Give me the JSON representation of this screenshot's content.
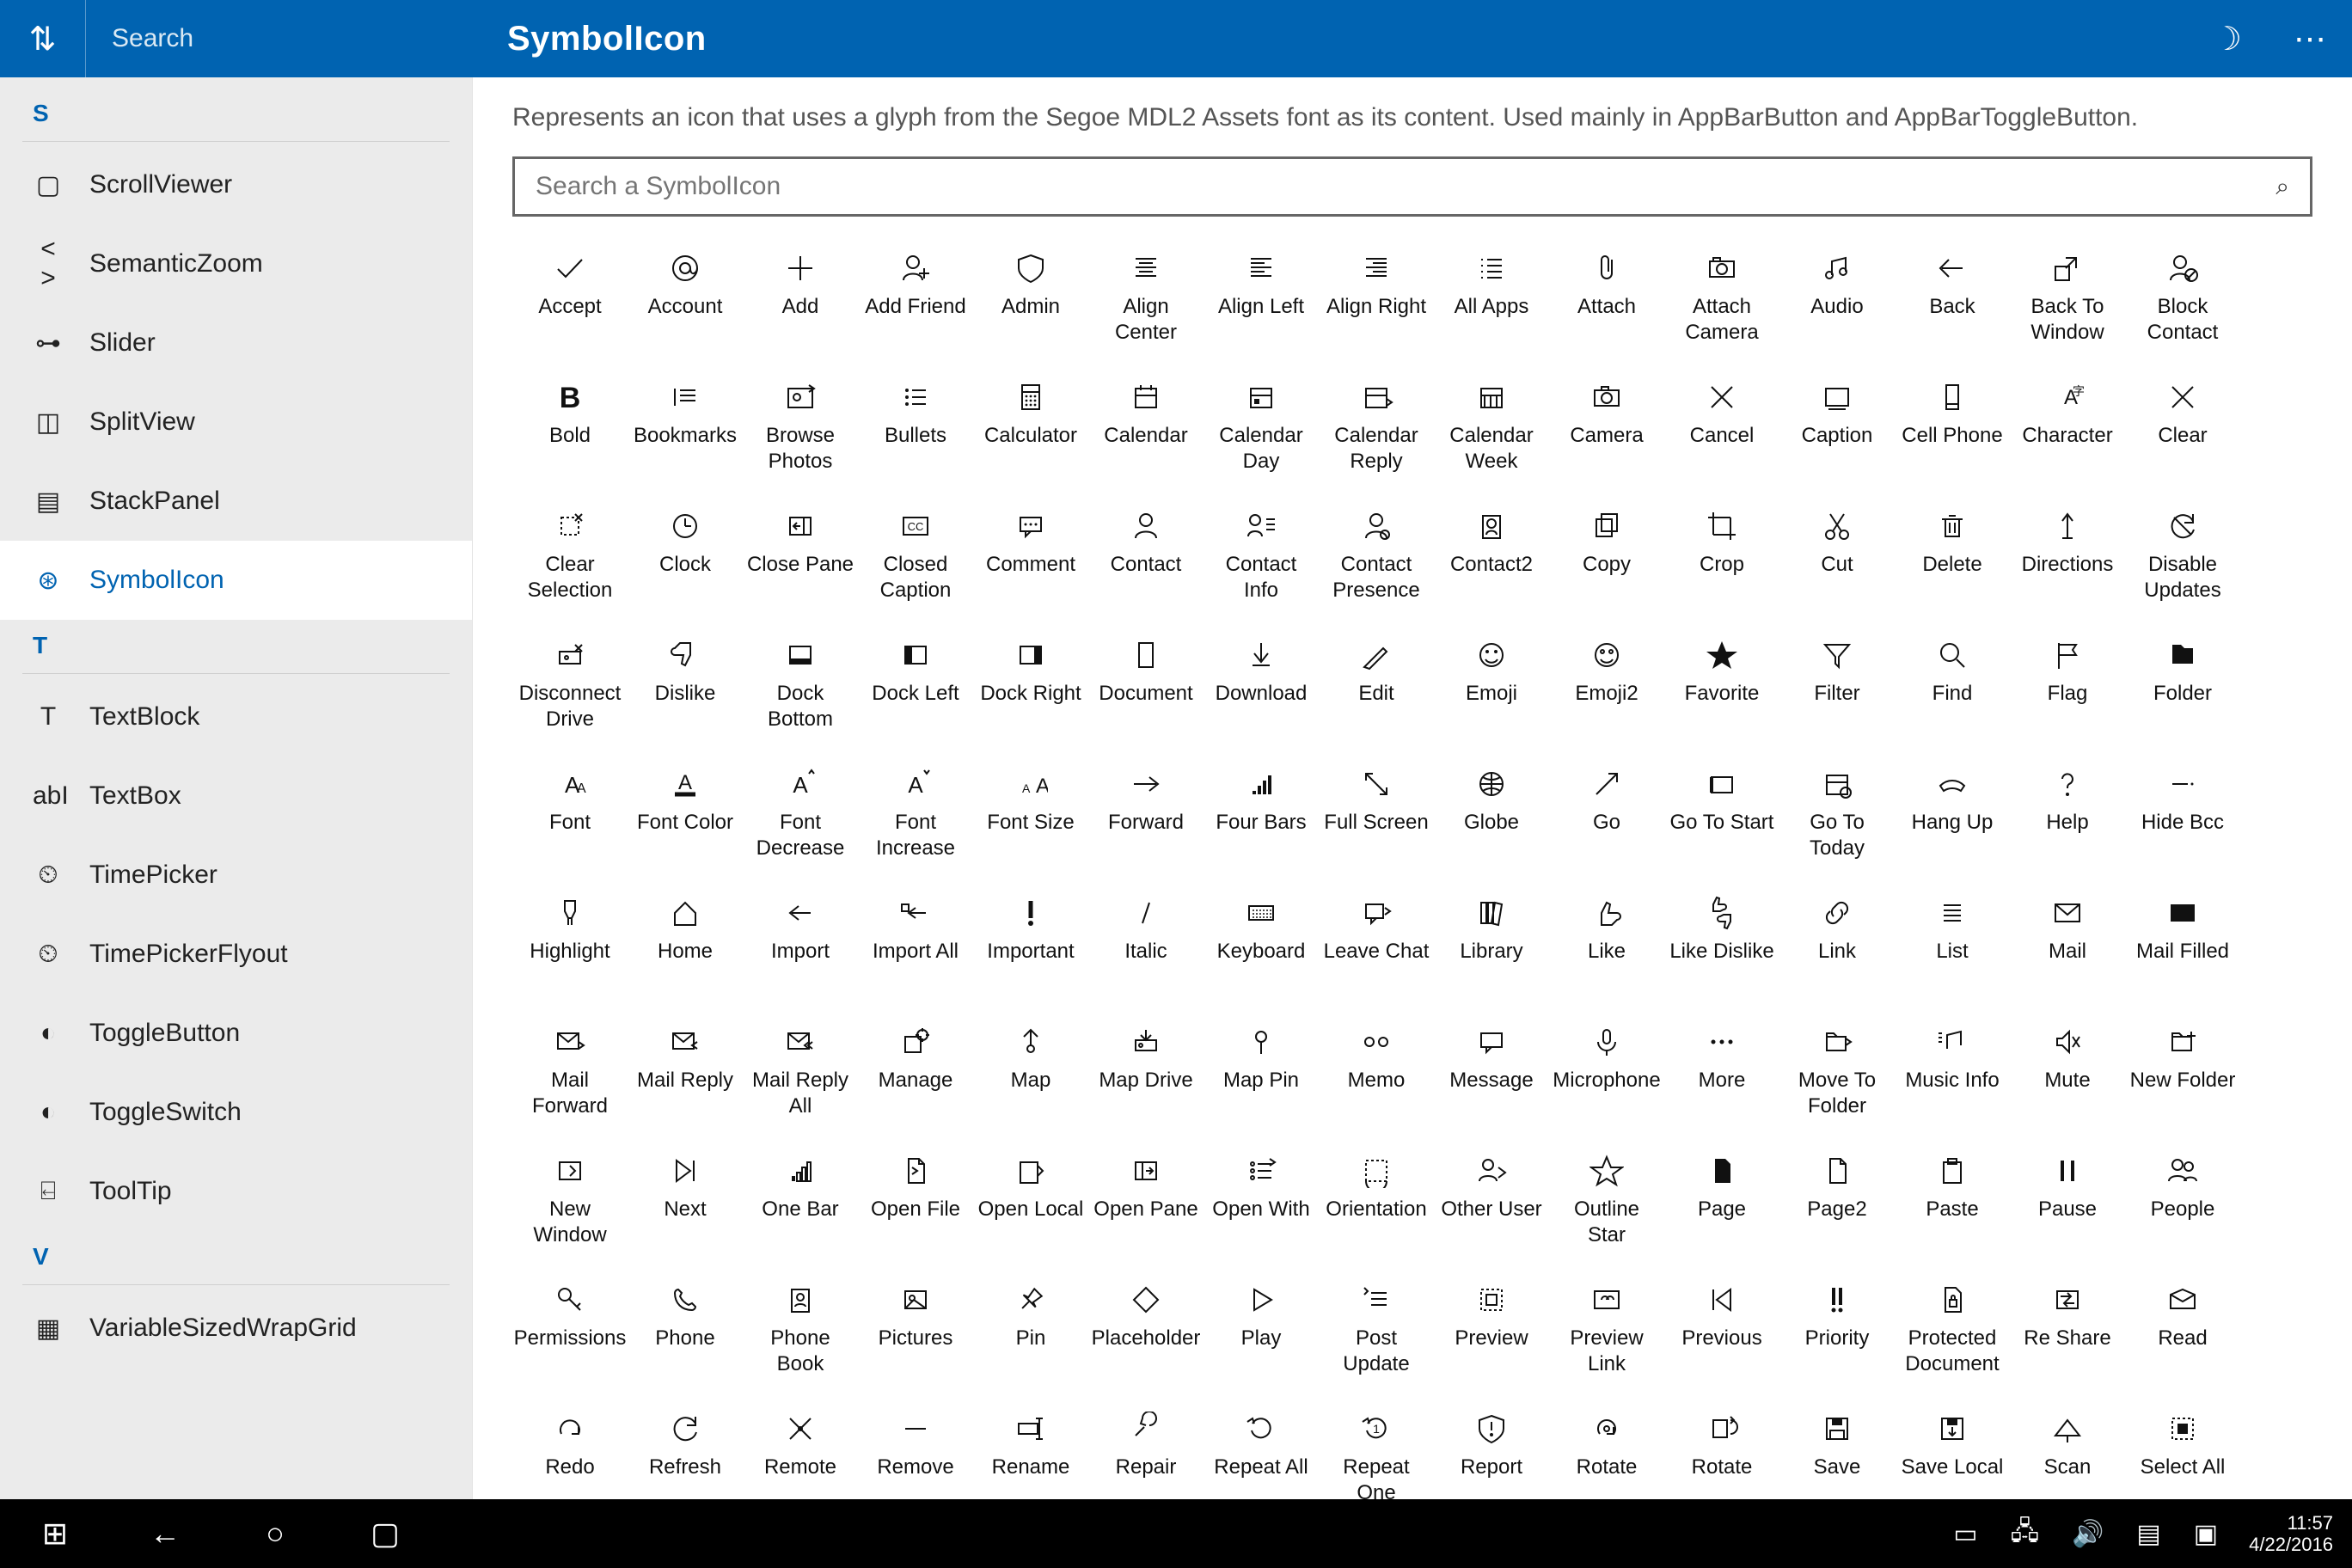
{
  "titlebar": {
    "search_placeholder": "Search",
    "title": "SymbolIcon"
  },
  "sidebar": {
    "sections": [
      {
        "letter": "S",
        "items": [
          {
            "icon": "▢",
            "label": "ScrollViewer"
          },
          {
            "icon": "< >",
            "label": "SemanticZoom"
          },
          {
            "icon": "⊶",
            "label": "Slider"
          },
          {
            "icon": "◫",
            "label": "SplitView"
          },
          {
            "icon": "▤",
            "label": "StackPanel"
          },
          {
            "icon": "⊛",
            "label": "SymbolIcon",
            "selected": true
          }
        ]
      },
      {
        "letter": "T",
        "items": [
          {
            "icon": "T",
            "label": "TextBlock"
          },
          {
            "icon": "abI",
            "label": "TextBox"
          },
          {
            "icon": "⏲",
            "label": "TimePicker"
          },
          {
            "icon": "⏲",
            "label": "TimePickerFlyout"
          },
          {
            "icon": "◐",
            "label": "ToggleButton"
          },
          {
            "icon": "◐",
            "label": "ToggleSwitch"
          },
          {
            "icon": "⍇",
            "label": "ToolTip"
          }
        ]
      },
      {
        "letter": "V",
        "items": [
          {
            "icon": "▦",
            "label": "VariableSizedWrapGrid"
          }
        ]
      }
    ]
  },
  "main": {
    "description": "Represents an icon that uses a glyph from the Segoe MDL2 Assets font as its content. Used mainly in AppBarButton and AppBarToggleButton.",
    "search_placeholder": "Search a SymbolIcon",
    "symbols": [
      {
        "g": "check",
        "l": "Accept"
      },
      {
        "g": "at",
        "l": "Account"
      },
      {
        "g": "plus",
        "l": "Add"
      },
      {
        "g": "addfriend",
        "l": "Add Friend"
      },
      {
        "g": "shield",
        "l": "Admin"
      },
      {
        "g": "alignc",
        "l": "Align Center"
      },
      {
        "g": "alignl",
        "l": "Align Left"
      },
      {
        "g": "alignr",
        "l": "Align Right"
      },
      {
        "g": "apps",
        "l": "All Apps"
      },
      {
        "g": "clip",
        "l": "Attach"
      },
      {
        "g": "attachcam",
        "l": "Attach Camera"
      },
      {
        "g": "audio",
        "l": "Audio"
      },
      {
        "g": "back",
        "l": "Back"
      },
      {
        "g": "backwin",
        "l": "Back To Window"
      },
      {
        "g": "blockcontact",
        "l": "Block Contact"
      },
      {
        "g": "bold",
        "l": "Bold"
      },
      {
        "g": "bookmarks",
        "l": "Bookmarks"
      },
      {
        "g": "browse",
        "l": "Browse Photos"
      },
      {
        "g": "bullets",
        "l": "Bullets"
      },
      {
        "g": "calc",
        "l": "Calculator"
      },
      {
        "g": "cal",
        "l": "Calendar"
      },
      {
        "g": "calday",
        "l": "Calendar Day"
      },
      {
        "g": "calreply",
        "l": "Calendar Reply"
      },
      {
        "g": "calweek",
        "l": "Calendar Week"
      },
      {
        "g": "camera",
        "l": "Camera"
      },
      {
        "g": "x",
        "l": "Cancel"
      },
      {
        "g": "caption",
        "l": "Caption"
      },
      {
        "g": "phone",
        "l": "Cell Phone"
      },
      {
        "g": "char",
        "l": "Character"
      },
      {
        "g": "x",
        "l": "Clear"
      },
      {
        "g": "clearsel",
        "l": "Clear Selection"
      },
      {
        "g": "clock",
        "l": "Clock"
      },
      {
        "g": "closepane",
        "l": "Close Pane"
      },
      {
        "g": "cc",
        "l": "Closed Caption"
      },
      {
        "g": "comment",
        "l": "Comment"
      },
      {
        "g": "contact",
        "l": "Contact"
      },
      {
        "g": "contactinfo",
        "l": "Contact Info"
      },
      {
        "g": "contactpres",
        "l": "Contact Presence"
      },
      {
        "g": "contact2",
        "l": "Contact2"
      },
      {
        "g": "copy",
        "l": "Copy"
      },
      {
        "g": "crop",
        "l": "Crop"
      },
      {
        "g": "cut",
        "l": "Cut"
      },
      {
        "g": "trash",
        "l": "Delete"
      },
      {
        "g": "directions",
        "l": "Directions"
      },
      {
        "g": "disableup",
        "l": "Disable Updates"
      },
      {
        "g": "discdrive",
        "l": "Disconnect Drive"
      },
      {
        "g": "dislike",
        "l": "Dislike"
      },
      {
        "g": "dockb",
        "l": "Dock Bottom"
      },
      {
        "g": "dockl",
        "l": "Dock Left"
      },
      {
        "g": "dockr",
        "l": "Dock Right"
      },
      {
        "g": "doc",
        "l": "Document"
      },
      {
        "g": "download",
        "l": "Download"
      },
      {
        "g": "edit",
        "l": "Edit"
      },
      {
        "g": "emoji",
        "l": "Emoji"
      },
      {
        "g": "emoji2",
        "l": "Emoji2"
      },
      {
        "g": "star",
        "l": "Favorite"
      },
      {
        "g": "filter",
        "l": "Filter"
      },
      {
        "g": "find",
        "l": "Find"
      },
      {
        "g": "flag",
        "l": "Flag"
      },
      {
        "g": "folder",
        "l": "Folder"
      },
      {
        "g": "font",
        "l": "Font"
      },
      {
        "g": "fontcolor",
        "l": "Font Color"
      },
      {
        "g": "fontdec",
        "l": "Font Decrease"
      },
      {
        "g": "fontinc",
        "l": "Font Increase"
      },
      {
        "g": "fontsize",
        "l": "Font Size"
      },
      {
        "g": "forward",
        "l": "Forward"
      },
      {
        "g": "bars4",
        "l": "Four Bars"
      },
      {
        "g": "fullscreen",
        "l": "Full Screen"
      },
      {
        "g": "globe",
        "l": "Globe"
      },
      {
        "g": "go",
        "l": "Go"
      },
      {
        "g": "gostart",
        "l": "Go To Start"
      },
      {
        "g": "gotoday",
        "l": "Go To Today"
      },
      {
        "g": "hangup",
        "l": "Hang Up"
      },
      {
        "g": "help",
        "l": "Help"
      },
      {
        "g": "hidebcc",
        "l": "Hide Bcc"
      },
      {
        "g": "highlight",
        "l": "Highlight"
      },
      {
        "g": "home",
        "l": "Home"
      },
      {
        "g": "import",
        "l": "Import"
      },
      {
        "g": "importall",
        "l": "Import All"
      },
      {
        "g": "important",
        "l": "Important"
      },
      {
        "g": "italic",
        "l": "Italic"
      },
      {
        "g": "keyboard",
        "l": "Keyboard"
      },
      {
        "g": "leavechat",
        "l": "Leave Chat"
      },
      {
        "g": "library",
        "l": "Library"
      },
      {
        "g": "like",
        "l": "Like"
      },
      {
        "g": "likedis",
        "l": "Like Dislike"
      },
      {
        "g": "link",
        "l": "Link"
      },
      {
        "g": "list",
        "l": "List"
      },
      {
        "g": "mail",
        "l": "Mail"
      },
      {
        "g": "mailfill",
        "l": "Mail Filled"
      },
      {
        "g": "mailfwd",
        "l": "Mail Forward"
      },
      {
        "g": "mailreply",
        "l": "Mail Reply"
      },
      {
        "g": "mailreplyall",
        "l": "Mail Reply All"
      },
      {
        "g": "manage",
        "l": "Manage"
      },
      {
        "g": "map",
        "l": "Map"
      },
      {
        "g": "mapdrive",
        "l": "Map Drive"
      },
      {
        "g": "mappin",
        "l": "Map Pin"
      },
      {
        "g": "memo",
        "l": "Memo"
      },
      {
        "g": "message",
        "l": "Message"
      },
      {
        "g": "mic",
        "l": "Microphone"
      },
      {
        "g": "more",
        "l": "More"
      },
      {
        "g": "movefolder",
        "l": "Move To Folder"
      },
      {
        "g": "musicinfo",
        "l": "Music Info"
      },
      {
        "g": "mute",
        "l": "Mute"
      },
      {
        "g": "newfolder",
        "l": "New Folder"
      },
      {
        "g": "newwin",
        "l": "New Window"
      },
      {
        "g": "next",
        "l": "Next"
      },
      {
        "g": "bar1",
        "l": "One Bar"
      },
      {
        "g": "openfile",
        "l": "Open File"
      },
      {
        "g": "openlocal",
        "l": "Open Local"
      },
      {
        "g": "openpane",
        "l": "Open Pane"
      },
      {
        "g": "openwith",
        "l": "Open With"
      },
      {
        "g": "orientation",
        "l": "Orientation"
      },
      {
        "g": "otheruser",
        "l": "Other User"
      },
      {
        "g": "outlinestar",
        "l": "Outline Star"
      },
      {
        "g": "page",
        "l": "Page"
      },
      {
        "g": "page2",
        "l": "Page2"
      },
      {
        "g": "paste",
        "l": "Paste"
      },
      {
        "g": "pause",
        "l": "Pause"
      },
      {
        "g": "people",
        "l": "People"
      },
      {
        "g": "permissions",
        "l": "Permissions"
      },
      {
        "g": "phone2",
        "l": "Phone"
      },
      {
        "g": "phonebook",
        "l": "Phone Book"
      },
      {
        "g": "pictures",
        "l": "Pictures"
      },
      {
        "g": "pin",
        "l": "Pin"
      },
      {
        "g": "placeholder",
        "l": "Placeholder"
      },
      {
        "g": "play",
        "l": "Play"
      },
      {
        "g": "postupdate",
        "l": "Post Update"
      },
      {
        "g": "preview",
        "l": "Preview"
      },
      {
        "g": "previewlink",
        "l": "Preview Link"
      },
      {
        "g": "previous",
        "l": "Previous"
      },
      {
        "g": "priority",
        "l": "Priority"
      },
      {
        "g": "protectdoc",
        "l": "Protected Document"
      },
      {
        "g": "reshare",
        "l": "Re Share"
      },
      {
        "g": "read",
        "l": "Read"
      },
      {
        "g": "redo",
        "l": "Redo"
      },
      {
        "g": "refresh",
        "l": "Refresh"
      },
      {
        "g": "remote",
        "l": "Remote"
      },
      {
        "g": "remove",
        "l": "Remove"
      },
      {
        "g": "rename",
        "l": "Rename"
      },
      {
        "g": "repair",
        "l": "Repair"
      },
      {
        "g": "repeatall",
        "l": "Repeat All"
      },
      {
        "g": "repeatone",
        "l": "Repeat One"
      },
      {
        "g": "report",
        "l": "Report"
      },
      {
        "g": "rotate",
        "l": "Rotate"
      },
      {
        "g": "rotate2",
        "l": "Rotate"
      },
      {
        "g": "save",
        "l": "Save"
      },
      {
        "g": "savelocal",
        "l": "Save Local"
      },
      {
        "g": "scan",
        "l": "Scan"
      },
      {
        "g": "selectall",
        "l": "Select All"
      }
    ]
  },
  "taskbar": {
    "time": "11:57",
    "date": "4/22/2016"
  }
}
